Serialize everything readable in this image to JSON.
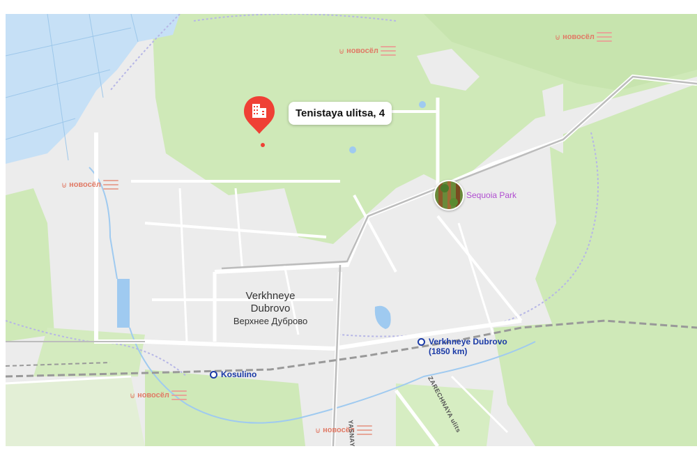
{
  "map": {
    "pin": {
      "address": "Tenistaya ulitsa, 4",
      "icon": "building-icon",
      "color": "#ef4035"
    },
    "poi": {
      "name": "Sequoia Park",
      "icon": "park-photo-icon",
      "color": "#b04ed0"
    },
    "settlement": {
      "name_en_line1": "Verkhneye",
      "name_en_line2": "Dubrovo",
      "name_ru": "Верхнее Дуброво"
    },
    "stations": [
      {
        "name_line1": "Verkhneye Dubrovo",
        "name_line2": "(1850 km)"
      },
      {
        "name_line1": "Kosulino",
        "name_line2": ""
      }
    ],
    "streets": [
      "YASNAYA UL",
      "ZARECHNAYA ulits"
    ],
    "ad_logo": {
      "brand": "новосёл",
      "icon": "novosel-logo-icon"
    },
    "colors": {
      "forest": "#cfe9b8",
      "water": "#c6e0f6",
      "urban": "#ececec",
      "road": "#ffffff",
      "railway": "#aaaaaa",
      "station": "#1a3aa6"
    }
  }
}
